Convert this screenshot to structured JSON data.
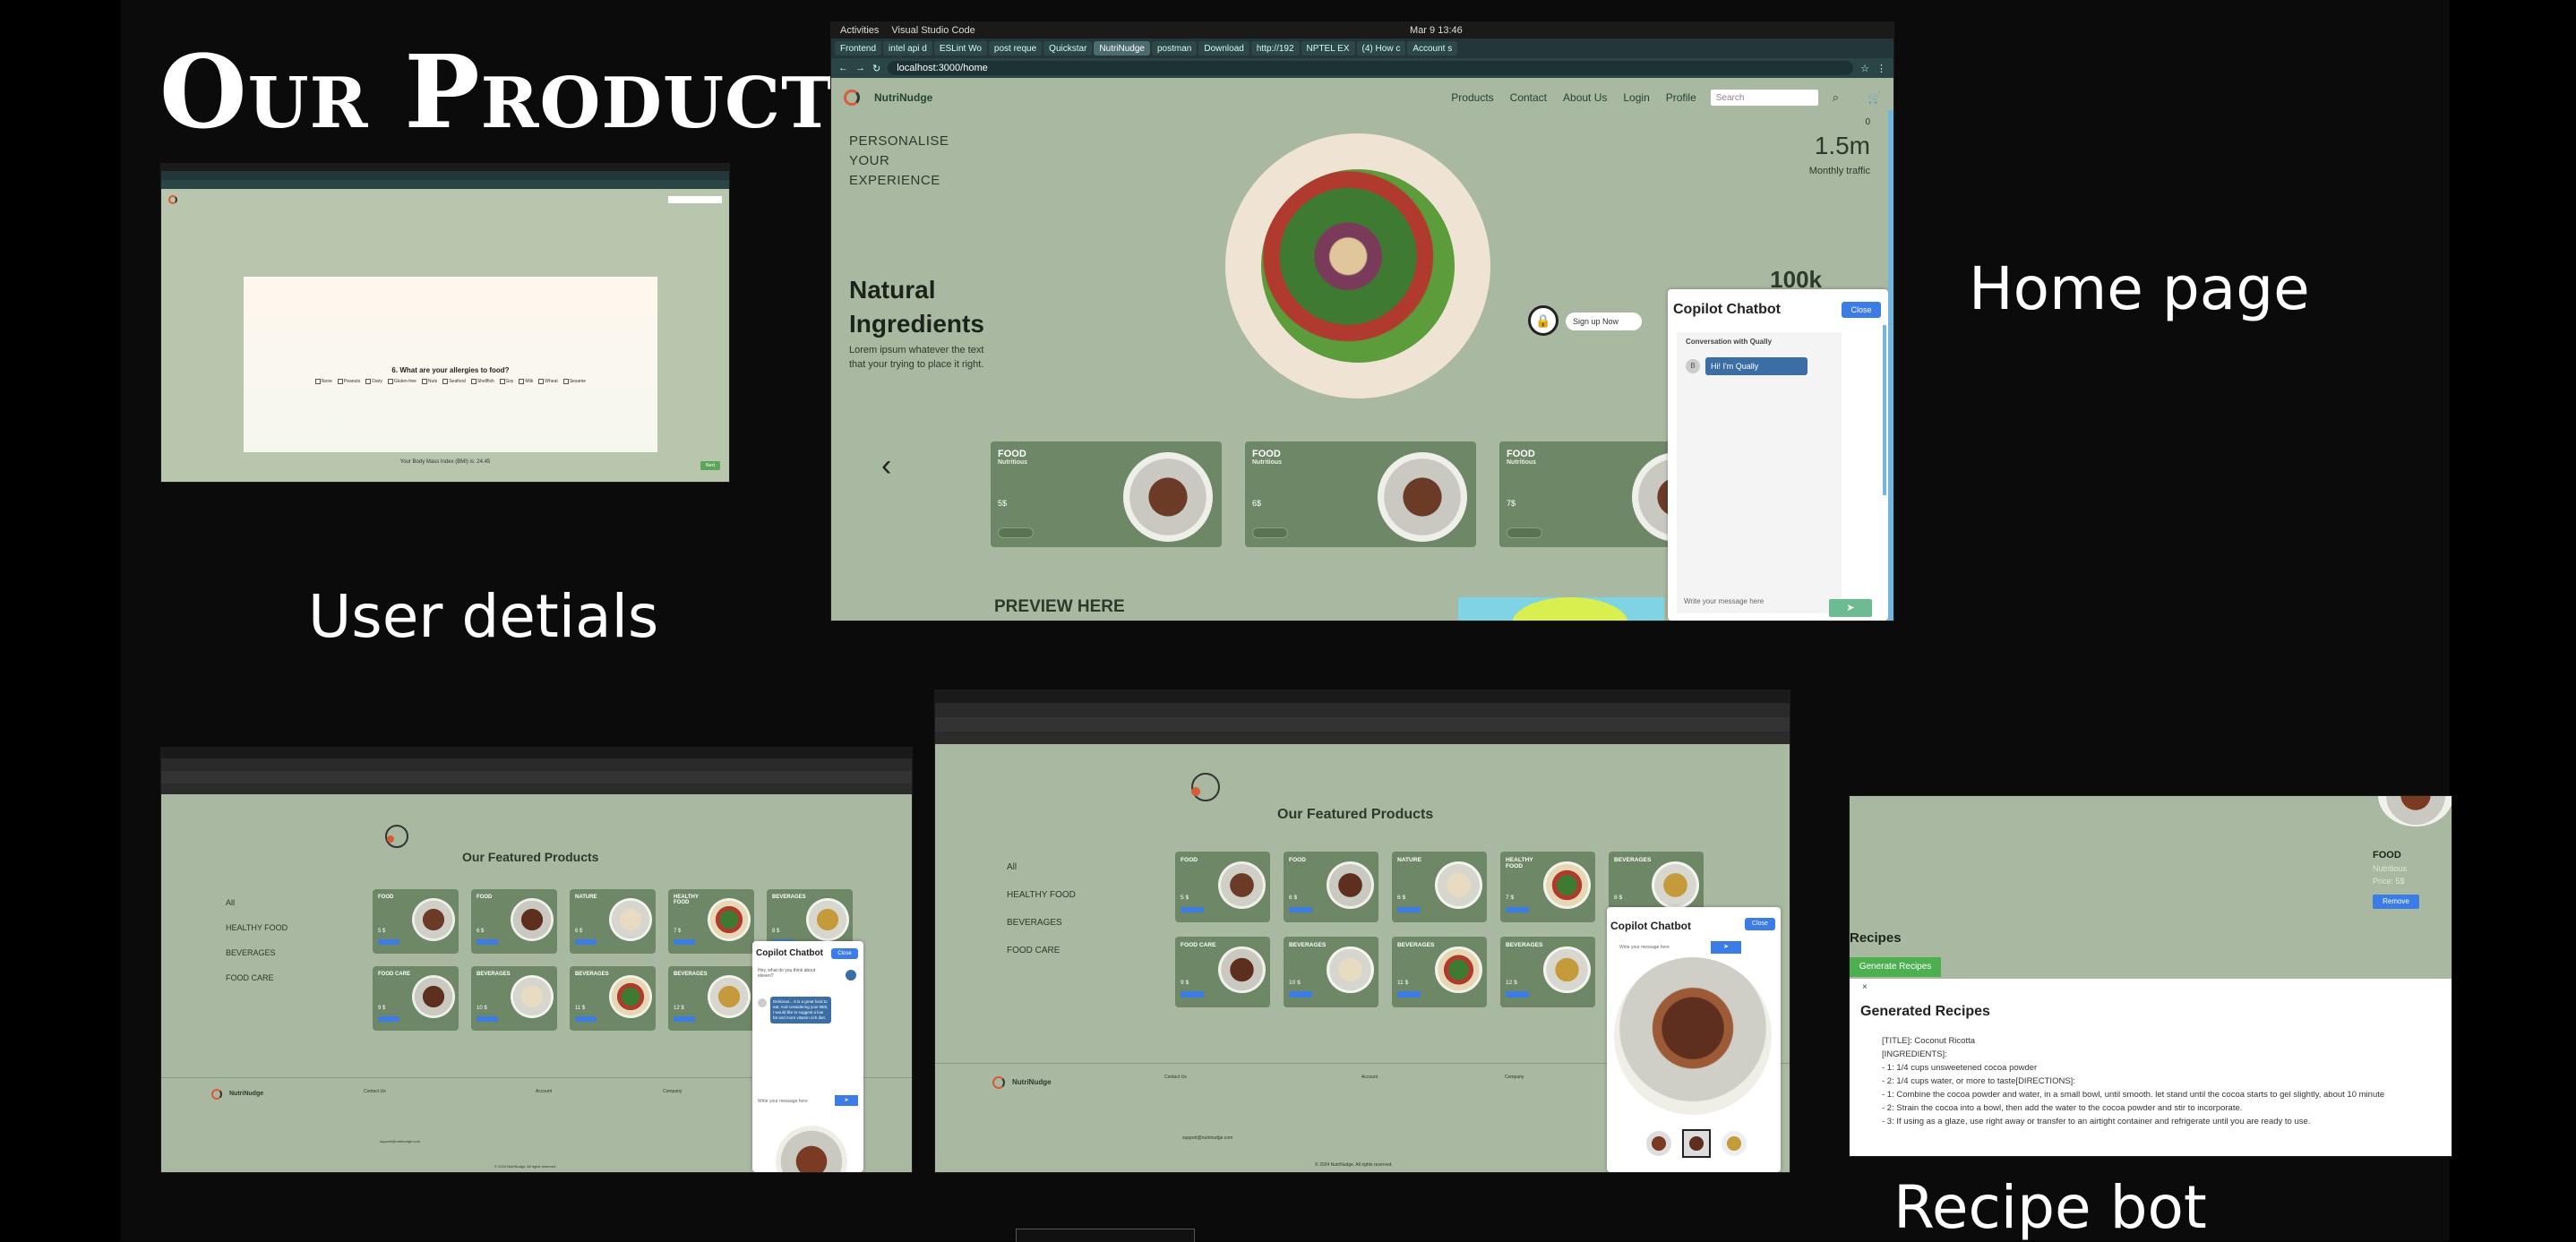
{
  "slide": {
    "title": "Our Product:",
    "captions": {
      "home": "Home page",
      "user": "User detials",
      "recipe": "Recipe bot"
    }
  },
  "home_shot": {
    "system_bar": {
      "activities": "Activities",
      "app": "Visual Studio Code",
      "clock": "Mar 9 13:46"
    },
    "tabs": [
      "Frontend",
      "intel api d",
      "ESLint Wo",
      "post reque",
      "Quickstar",
      "NutriNudge",
      "postman",
      "Download",
      "http://192",
      "NPTEL EX",
      "(4) How c",
      "Account s"
    ],
    "active_tab": 5,
    "url": "localhost:3000/home",
    "brand": "NutriNudge",
    "nav": [
      "Products",
      "Contact",
      "About Us",
      "Login",
      "Profile"
    ],
    "search_placeholder": "Search",
    "cart_count": "0",
    "hero_left": "PERSONALISE\nYOUR\nEXPERIENCE",
    "stat_value": "1.5m",
    "stat_label": "Monthly traffic",
    "stat2_value": "100k",
    "heading": "Natural\nIngredients",
    "body": "Lorem ipsum whatever the text that your trying to place it right.",
    "signup_label": "Sign up Now",
    "cards": [
      {
        "cat": "FOOD",
        "sub": "Nutritious",
        "price": "5$"
      },
      {
        "cat": "FOOD",
        "sub": "Nutritious",
        "price": "6$"
      },
      {
        "cat": "FOOD",
        "sub": "Nutritious",
        "price": "7$"
      }
    ],
    "preview": "PREVIEW HERE",
    "chat": {
      "title": "Copilot Chatbot",
      "close": "Close",
      "subtitle": "Conversation with Qually",
      "greeting": "Hi! I'm Qually",
      "avatar": "B",
      "placeholder": "Write your message here"
    }
  },
  "user_shot": {
    "question": "6. What are your allergies to food?",
    "options": [
      "None",
      "Peanuts",
      "Dairy",
      "Gluten-free",
      "Nuts",
      "Seafood",
      "Shellfish",
      "Soy",
      "Milk",
      "Wheat",
      "Sesame"
    ],
    "footer": "Your Body Mass Index (BMI) is: 24.45",
    "next": "Next"
  },
  "featured_left": {
    "title": "Our Featured Products",
    "categories": [
      "All",
      "HEALTHY FOOD",
      "BEVERAGES",
      "FOOD CARE"
    ],
    "row1": [
      {
        "cat": "FOOD",
        "price": "5 $"
      },
      {
        "cat": "FOOD",
        "price": "6 $"
      },
      {
        "cat": "NATURE",
        "price": "6 $"
      },
      {
        "cat": "HEALTHY FOOD",
        "price": "7 $"
      },
      {
        "cat": "BEVERAGES",
        "price": "8 $"
      }
    ],
    "row2": [
      {
        "cat": "FOOD CARE",
        "price": "9 $"
      },
      {
        "cat": "BEVERAGES",
        "price": "10 $"
      },
      {
        "cat": "BEVERAGES",
        "price": "11 $"
      },
      {
        "cat": "BEVERAGES",
        "price": "12 $"
      }
    ],
    "chat": {
      "title": "Copilot Chatbot",
      "close": "Close",
      "question": "Hey, what do you think about eleven?",
      "answer": "Delicious... It is a great food to eat. And considering your BMI, I would like to suggest a low fat and more vitamin rich diet.",
      "placeholder": "Write your message here"
    },
    "footer": {
      "brand": "NutriNudge",
      "col1": "Contact Us",
      "col2": "Account",
      "col3": "Company",
      "email": "support@nutrinudge.com",
      "copyright": "© 2024 NutriNudge. All rights reserved."
    }
  },
  "featured_right": {
    "title": "Our Featured Products",
    "categories": [
      "All",
      "HEALTHY FOOD",
      "BEVERAGES",
      "FOOD CARE"
    ],
    "row1": [
      {
        "cat": "FOOD",
        "price": "5 $"
      },
      {
        "cat": "FOOD",
        "price": "6 $"
      },
      {
        "cat": "NATURE",
        "price": "6 $"
      },
      {
        "cat": "HEALTHY FOOD",
        "price": "7 $"
      },
      {
        "cat": "BEVERAGES",
        "price": "8 $"
      }
    ],
    "row2": [
      {
        "cat": "FOOD CARE",
        "price": "9 $"
      },
      {
        "cat": "BEVERAGES",
        "price": "10 $"
      },
      {
        "cat": "BEVERAGES",
        "price": "11 $"
      },
      {
        "cat": "BEVERAGES",
        "price": "12 $"
      }
    ],
    "chat": {
      "title": "Copilot Chatbot",
      "close": "Close",
      "placeholder": "Write your message here"
    },
    "footer": {
      "brand": "NutriNudge",
      "col1": "Contact Us",
      "col2": "Account",
      "col3": "Company",
      "email": "support@nutrinudge.com",
      "copyright": "© 2024 NutriNudge. All rights reserved."
    }
  },
  "recipe_shot": {
    "product_cat": "FOOD",
    "product_sub": "Nutritious",
    "product_price": "Price: 5$",
    "remove": "Remove",
    "recipes_heading": "Recipes",
    "generate": "Generate Recipes",
    "close_x": "×",
    "generated_heading": "Generated Recipes",
    "lines": [
      "[TITLE]: Coconut Ricotta",
      "[INGREDIENTS]:",
      "- 1: 1/4 cups unsweetened cocoa powder",
      "- 2: 1/4 cups water, or more to taste[DIRECTIONS]:",
      "- 1: Combine the cocoa powder and water, in a small bowl, until smooth. let stand until the cocoa starts to gel slightly, about 10 minute",
      "- 2: Strain the cocoa into a bowl, then add the water to the cocoa powder and stir to incorporate.",
      "- 3: If using as a glaze, use right away or transfer to an airtight container and refrigerate until you are ready to use."
    ]
  },
  "colors": {
    "page_green": "#a9b8a0",
    "card_green": "#6e8766",
    "accent_blue": "#3c7ce6",
    "brand_orange": "#d85b3a"
  }
}
